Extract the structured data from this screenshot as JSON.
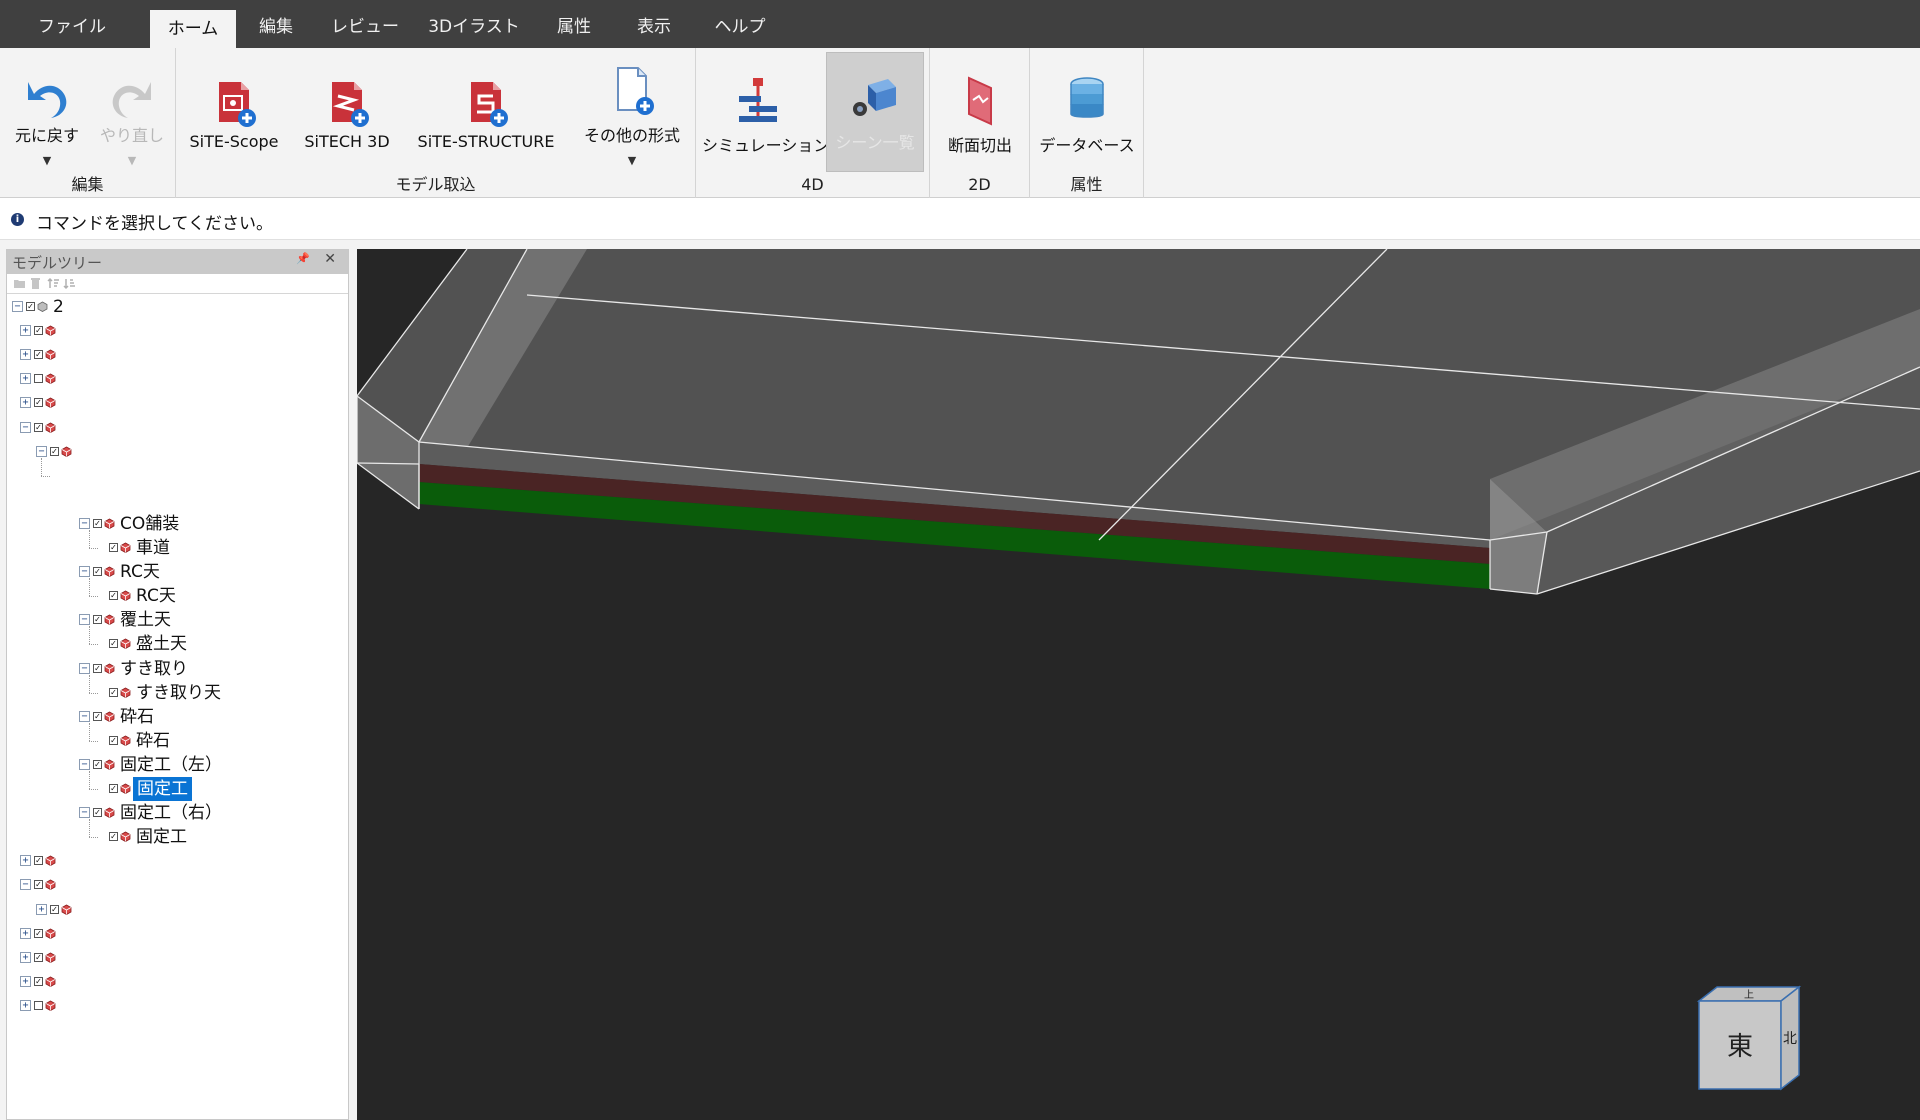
{
  "tabs": [
    {
      "label": "ファイル",
      "active": false
    },
    {
      "label": "ホーム",
      "active": true
    },
    {
      "label": "編集",
      "active": false
    },
    {
      "label": "レビュー",
      "active": false
    },
    {
      "label": "3Dイラスト",
      "active": false
    },
    {
      "label": "属性",
      "active": false
    },
    {
      "label": "表示",
      "active": false
    },
    {
      "label": "ヘルプ",
      "active": false
    }
  ],
  "ribbon": {
    "groups": {
      "edit": "編集",
      "model_import": "モデル取込",
      "fourd": "4D",
      "twod": "2D",
      "attr": "属性"
    },
    "buttons": {
      "undo": "元に戻す",
      "redo": "やり直し",
      "sitescope": "SiTE-Scope",
      "sitech3d": "SiTECH 3D",
      "sitestructure": "SiTE-STRUCTURE",
      "other_formats": "その他の形式",
      "simulation": "シミュレーション",
      "scene_list": "シーン一覧",
      "section_cut": "断面切出",
      "database": "データベース"
    },
    "accent_colors": {
      "undo": "#2f7fd0",
      "import_red": "#c9323a",
      "sim_red": "#d23a3a",
      "sim_blue": "#2c5fa8",
      "db_blue": "#4c9bd4"
    }
  },
  "command_bar": {
    "message": "コマンドを選択してください。"
  },
  "tree_panel": {
    "title": "モデルツリー",
    "root_label": "2",
    "nodes": {
      "co_pavement": "CO舗装",
      "roadway": "車道",
      "rc_group": "RC天",
      "rc_item": "RC天",
      "soil_cover": "覆土天",
      "embankment": "盛土天",
      "excavation": "すき取り",
      "excavation_item": "すき取り天",
      "crushed_stone": "砕石",
      "crushed_stone_item": "砕石",
      "fixed_left": "固定工（左）",
      "fixed_left_item": "固定工",
      "fixed_right": "固定工（右）",
      "fixed_right_item": "固定工"
    }
  },
  "viewcube": {
    "front": "東",
    "side": "北",
    "top": "上"
  },
  "viewport": {
    "background": "#262626",
    "surface_color": "#525252",
    "layer_colors": [
      "#4a2424",
      "#0a5c0a"
    ]
  }
}
